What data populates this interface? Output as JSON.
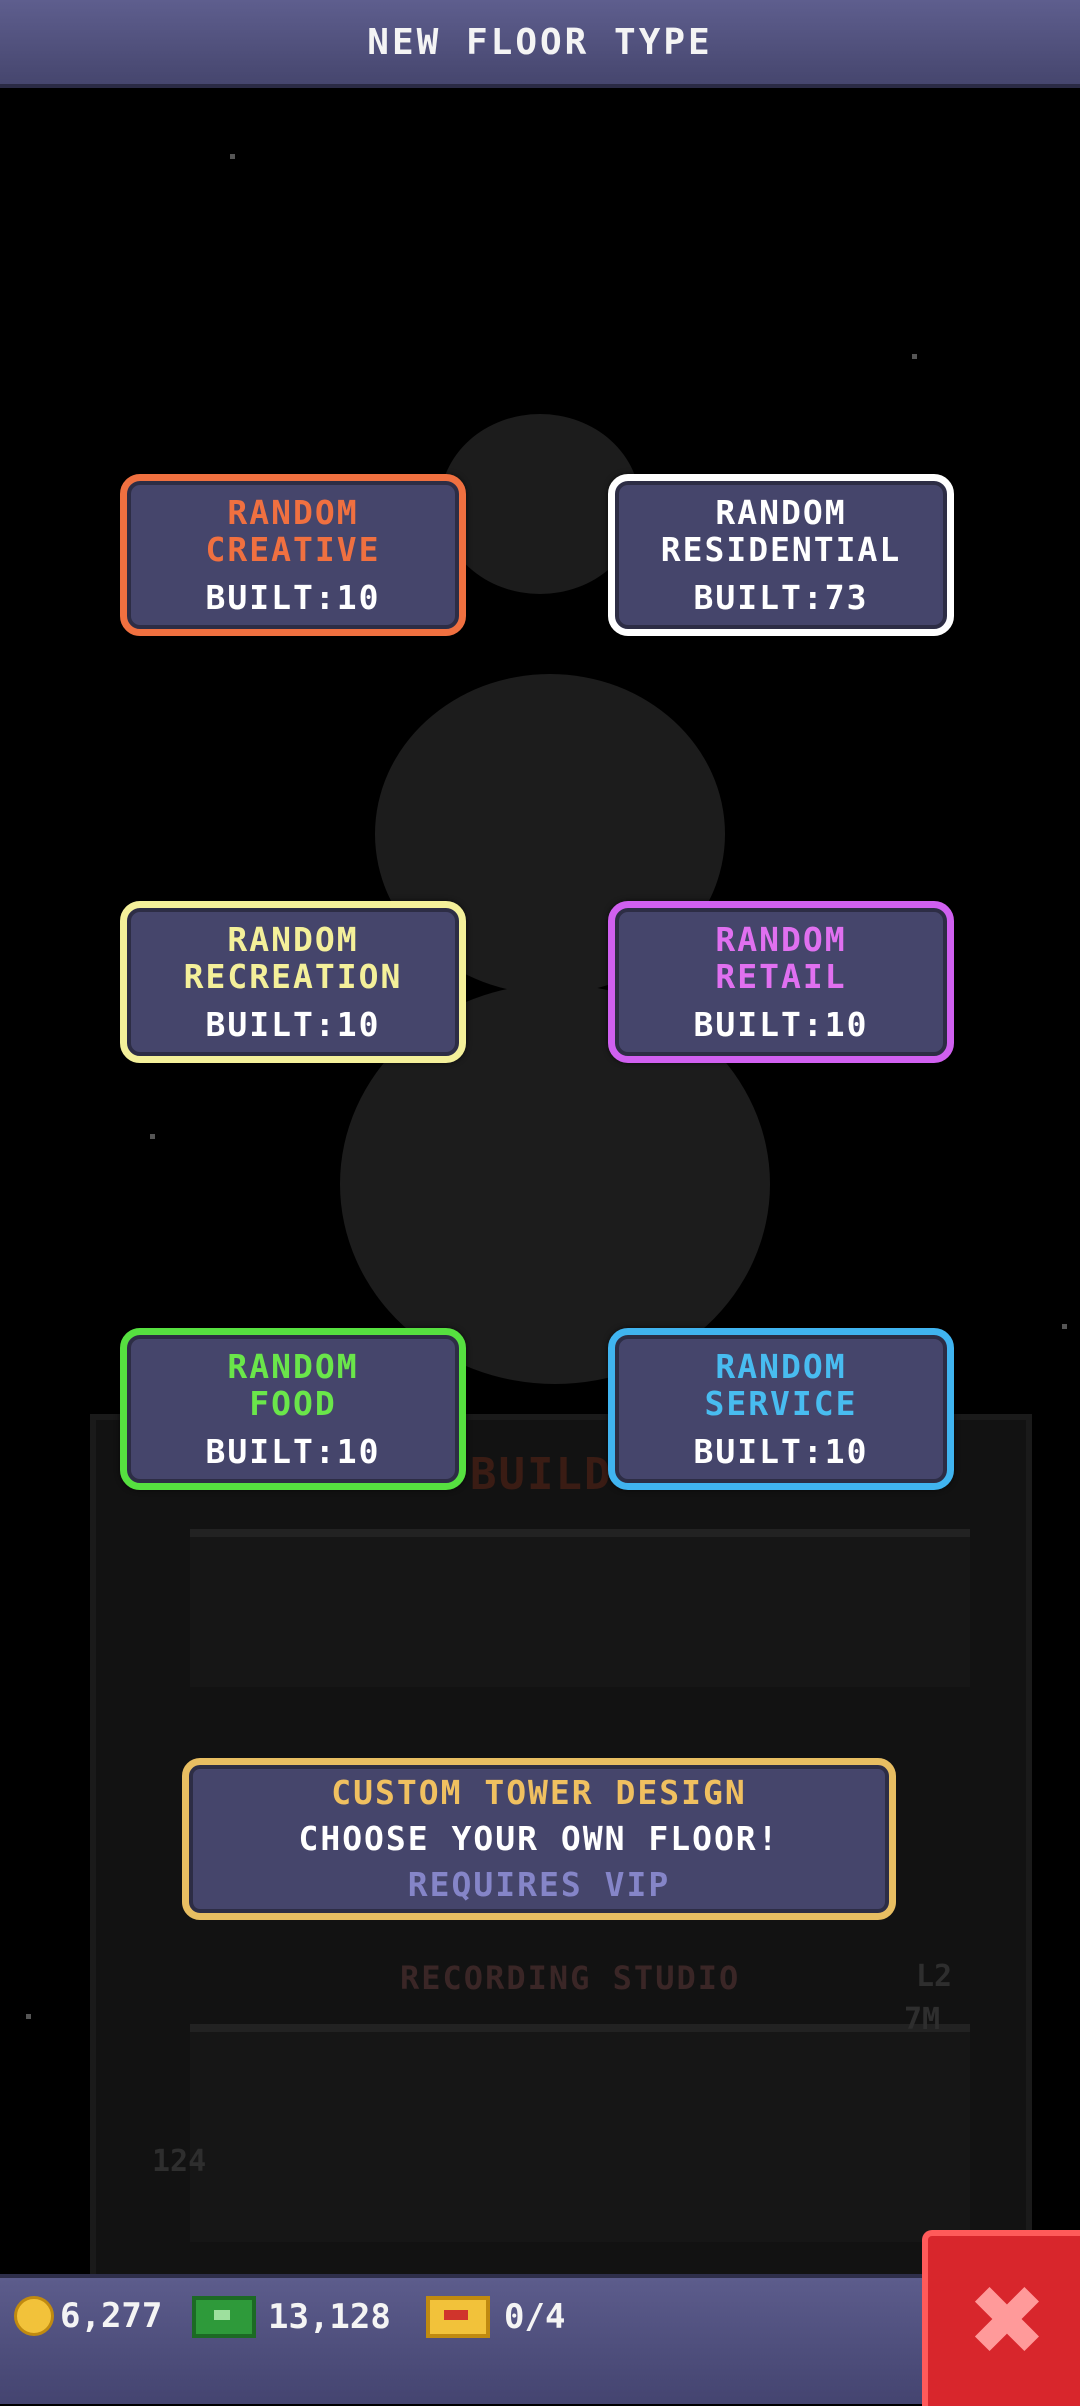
{
  "header": {
    "title": "NEW FLOOR TYPE"
  },
  "floor_types": [
    {
      "name_line1": "RANDOM",
      "name_line2": "CREATIVE",
      "built": "BUILT:10",
      "color": "#f07040"
    },
    {
      "name_line1": "RANDOM",
      "name_line2": "RESIDENTIAL",
      "built": "BUILT:73",
      "color": "#ffffff"
    },
    {
      "name_line1": "RANDOM",
      "name_line2": "RECREATION",
      "built": "BUILT:10",
      "color": "#f4f09a"
    },
    {
      "name_line1": "RANDOM",
      "name_line2": "RETAIL",
      "built": "BUILT:10",
      "color": "#e070f0"
    },
    {
      "name_line1": "RANDOM",
      "name_line2": "FOOD",
      "built": "BUILT:10",
      "color": "#6ae64a"
    },
    {
      "name_line1": "RANDOM",
      "name_line2": "SERVICE",
      "built": "BUILT:10",
      "color": "#48bcf0"
    }
  ],
  "custom_tower": {
    "title": "CUSTOM TOWER DESIGN",
    "subtitle": "CHOOSE YOUR OWN FLOOR!",
    "requirement": "REQUIRES VIP",
    "border_color": "#e8be62"
  },
  "background": {
    "floor_label": "RECORDING STUDIO",
    "level_label": "L2",
    "money_label": "7M",
    "floor_number": "124",
    "sign_text": "BUILD"
  },
  "status": {
    "coins": "6,277",
    "bux": "13,128",
    "vip_tickets": "0/4"
  },
  "icons": {
    "coin": "coin-icon",
    "bux": "cash-icon",
    "ticket": "ticket-icon",
    "close": "close-icon"
  },
  "colors": {
    "button_fill": "#45456b",
    "title_bar": "#52527e",
    "close_button": "#d8262c"
  }
}
